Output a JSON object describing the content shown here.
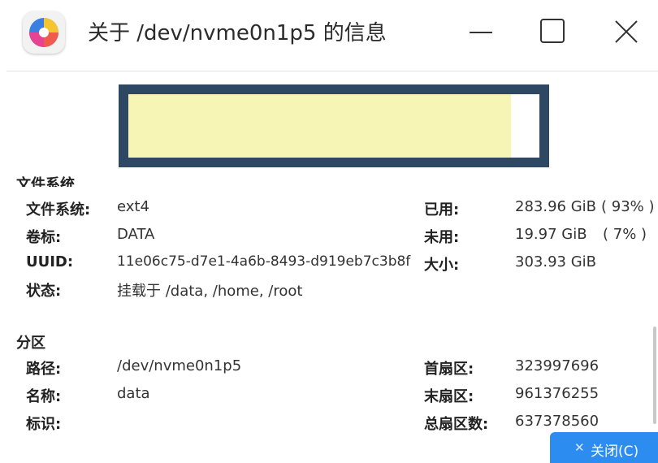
{
  "window": {
    "title": "关于 /dev/nvme0n1p5 的信息",
    "app_icon": "disk-utility-icon",
    "controls": [
      "minimize-icon",
      "maximize-icon",
      "close-icon"
    ]
  },
  "usage": {
    "used_fraction": 0.93,
    "bar_color": "#2e4863",
    "fill_color": "#f7f5b6"
  },
  "filesystem": {
    "heading": "文件系统",
    "fs_label": "文件系统:",
    "fs_value": "ext4",
    "volume_label": "卷标:",
    "volume_value": "DATA",
    "uuid_label": "UUID:",
    "uuid_value": "11e06c75-d7e1-4a6b-8493-d919eb7c3b8f",
    "status_label": "状态:",
    "status_value": "挂载于 /data, /home, /root",
    "used_label": "已用:",
    "used_value": "283.96 GiB",
    "used_pct": "( 93% )",
    "free_label": "未用:",
    "free_value": "19.97 GiB",
    "free_pct": "( 7% )",
    "size_label": "大小:",
    "size_value": "303.93 GiB"
  },
  "partition": {
    "heading": "分区",
    "path_label": "路径:",
    "path_value": "/dev/nvme0n1p5",
    "name_label": "名称:",
    "name_value": "data",
    "flags_label": "标识:",
    "flags_value": "",
    "first_sector_label": "首扇区:",
    "first_sector_value": "323997696",
    "last_sector_label": "末扇区:",
    "last_sector_value": "961376255",
    "total_sectors_label": "总扇区数:",
    "total_sectors_value": "637378560"
  },
  "footer": {
    "close_label": "关闭(C)",
    "close_icon": "x-icon",
    "accent": "#2d8cf0"
  }
}
